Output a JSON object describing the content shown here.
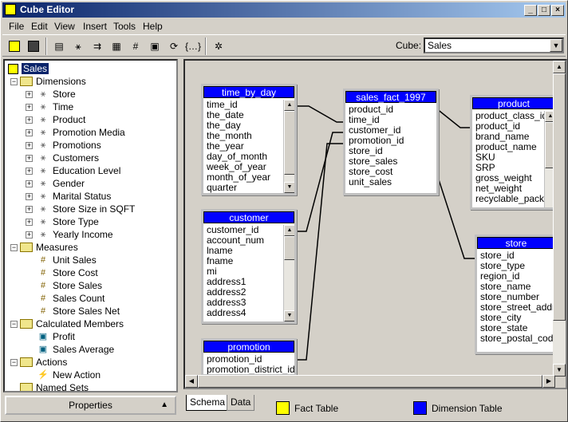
{
  "window": {
    "title": "Cube Editor"
  },
  "menu": {
    "items": [
      "File",
      "Edit",
      "View",
      "Insert",
      "Tools",
      "Help"
    ]
  },
  "toolbar": {
    "cube_label": "Cube:",
    "cube_value": "Sales",
    "buttons": [
      "new-cube-icon",
      "save-icon",
      "table-icon",
      "dimension-icon",
      "link-icon",
      "properties-icon",
      "measure-icon",
      "browse-data-icon",
      "process-icon",
      "calculated-member-icon",
      "wizard-icon"
    ]
  },
  "tree": {
    "root": "Sales",
    "dimensions_label": "Dimensions",
    "dimensions": [
      "Store",
      "Time",
      "Product",
      "Promotion Media",
      "Promotions",
      "Customers",
      "Education Level",
      "Gender",
      "Marital Status",
      "Store Size in SQFT",
      "Store Type",
      "Yearly Income"
    ],
    "measures_label": "Measures",
    "measures": [
      "Unit Sales",
      "Store Cost",
      "Store Sales",
      "Sales Count",
      "Store Sales Net"
    ],
    "calc_label": "Calculated Members",
    "calc_members": [
      "Profit",
      "Sales Average"
    ],
    "actions_label": "Actions",
    "actions": [
      "New Action"
    ],
    "named_sets_label": "Named Sets"
  },
  "properties_button": "Properties",
  "schema": {
    "tables": {
      "time_by_day": {
        "name": "time_by_day",
        "columns": [
          "time_id",
          "the_date",
          "the_day",
          "the_month",
          "the_year",
          "day_of_month",
          "week_of_year",
          "month_of_year",
          "quarter"
        ]
      },
      "sales_fact": {
        "name": "sales_fact_1997",
        "columns": [
          "product_id",
          "time_id",
          "customer_id",
          "promotion_id",
          "store_id",
          "store_sales",
          "store_cost",
          "unit_sales"
        ]
      },
      "product": {
        "name": "product",
        "columns": [
          "product_class_id",
          "product_id",
          "brand_name",
          "product_name",
          "SKU",
          "SRP",
          "gross_weight",
          "net_weight",
          "recyclable_packag"
        ]
      },
      "customer": {
        "name": "customer",
        "columns": [
          "customer_id",
          "account_num",
          "lname",
          "fname",
          "mi",
          "address1",
          "address2",
          "address3",
          "address4"
        ]
      },
      "store": {
        "name": "store",
        "columns": [
          "store_id",
          "store_type",
          "region_id",
          "store_name",
          "store_number",
          "store_street_addre",
          "store_city",
          "store_state",
          "store_postal_code"
        ]
      },
      "promotion": {
        "name": "promotion",
        "columns": [
          "promotion_id",
          "promotion_district_id"
        ]
      }
    }
  },
  "tabs": {
    "schema": "Schema",
    "data": "Data"
  },
  "legend": {
    "fact_label": "Fact Table",
    "fact_color": "#ffff00",
    "dim_label": "Dimension Table",
    "dim_color": "#0000ff"
  }
}
